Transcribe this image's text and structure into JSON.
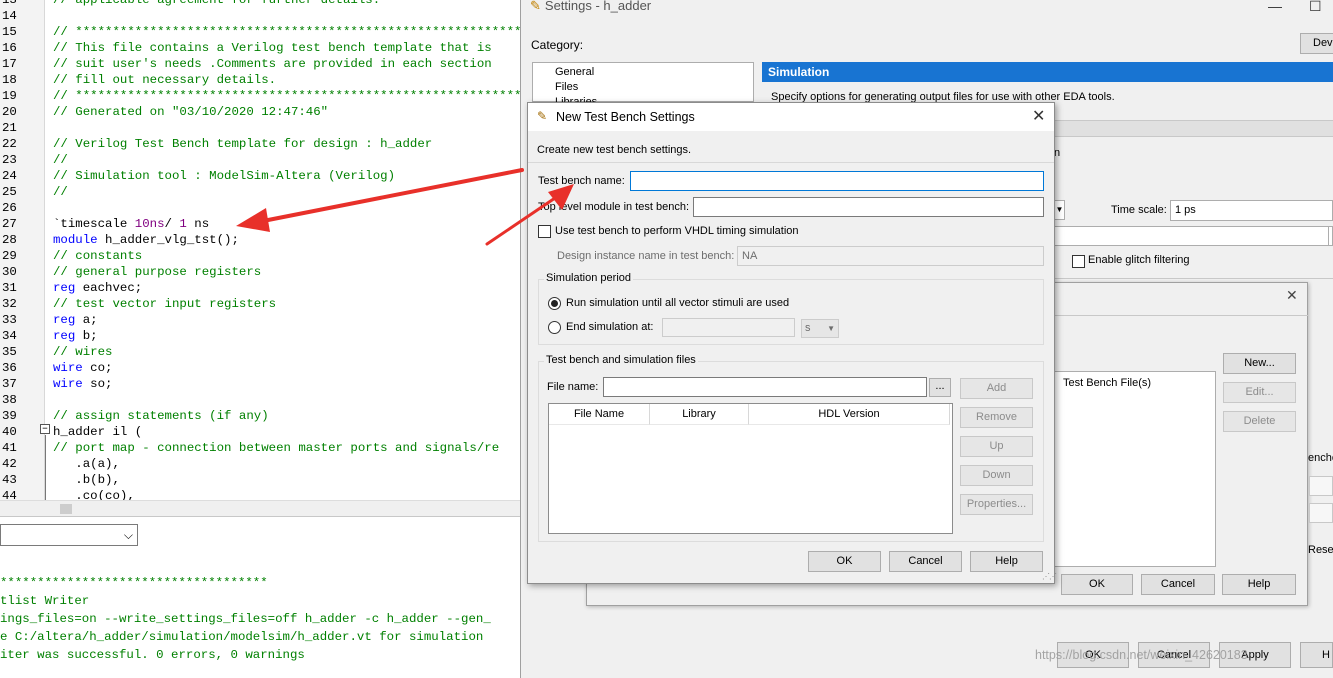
{
  "editor": {
    "lines": [
      {
        "num": "13",
        "parts": [
          {
            "t": "// applicable agreement for further details.",
            "c": "comment"
          }
        ]
      },
      {
        "num": "14",
        "parts": []
      },
      {
        "num": "15",
        "parts": [
          {
            "t": "// ********************************************************************",
            "c": "comment"
          }
        ]
      },
      {
        "num": "16",
        "parts": [
          {
            "t": "// This file contains a Verilog test bench template that is",
            "c": "comment"
          }
        ]
      },
      {
        "num": "17",
        "parts": [
          {
            "t": "// suit user's needs .Comments are provided in each section",
            "c": "comment"
          }
        ]
      },
      {
        "num": "18",
        "parts": [
          {
            "t": "// fill out necessary details.",
            "c": "comment"
          }
        ]
      },
      {
        "num": "19",
        "parts": [
          {
            "t": "// ********************************************************************",
            "c": "comment"
          }
        ]
      },
      {
        "num": "20",
        "parts": [
          {
            "t": "// Generated on \"03/10/2020 12:47:46\"",
            "c": "comment"
          }
        ]
      },
      {
        "num": "21",
        "parts": []
      },
      {
        "num": "22",
        "parts": [
          {
            "t": "// Verilog Test Bench template for design : h_adder",
            "c": "comment"
          }
        ]
      },
      {
        "num": "23",
        "parts": [
          {
            "t": "//",
            "c": "comment"
          }
        ]
      },
      {
        "num": "24",
        "parts": [
          {
            "t": "// Simulation tool : ModelSim-Altera (Verilog)",
            "c": "comment"
          }
        ]
      },
      {
        "num": "25",
        "parts": [
          {
            "t": "//",
            "c": "comment"
          }
        ]
      },
      {
        "num": "26",
        "parts": []
      },
      {
        "num": "27",
        "parts": [
          {
            "t": "`timescale ",
            "c": "text"
          },
          {
            "t": "10ns",
            "c": "num"
          },
          {
            "t": "/ ",
            "c": "text"
          },
          {
            "t": "1",
            "c": "num"
          },
          {
            "t": " ns",
            "c": "text"
          }
        ]
      },
      {
        "num": "28",
        "parts": [
          {
            "t": "module",
            "c": "kw"
          },
          {
            "t": " h_adder_vlg_tst();",
            "c": "text"
          }
        ]
      },
      {
        "num": "29",
        "parts": [
          {
            "t": "// constants",
            "c": "comment"
          }
        ]
      },
      {
        "num": "30",
        "parts": [
          {
            "t": "// general purpose registers",
            "c": "comment"
          }
        ]
      },
      {
        "num": "31",
        "parts": [
          {
            "t": "reg",
            "c": "kw"
          },
          {
            "t": " eachvec;",
            "c": "text"
          }
        ]
      },
      {
        "num": "32",
        "parts": [
          {
            "t": "// test vector input registers",
            "c": "comment"
          }
        ]
      },
      {
        "num": "33",
        "parts": [
          {
            "t": "reg",
            "c": "kw"
          },
          {
            "t": " a;",
            "c": "text"
          }
        ]
      },
      {
        "num": "34",
        "parts": [
          {
            "t": "reg",
            "c": "kw"
          },
          {
            "t": " b;",
            "c": "text"
          }
        ]
      },
      {
        "num": "35",
        "parts": [
          {
            "t": "// wires",
            "c": "comment"
          }
        ]
      },
      {
        "num": "36",
        "parts": [
          {
            "t": "wire",
            "c": "kw"
          },
          {
            "t": " co;",
            "c": "text"
          }
        ]
      },
      {
        "num": "37",
        "parts": [
          {
            "t": "wire",
            "c": "kw"
          },
          {
            "t": " so;",
            "c": "text"
          }
        ]
      },
      {
        "num": "38",
        "parts": []
      },
      {
        "num": "39",
        "parts": [
          {
            "t": "// assign statements (if any)",
            "c": "comment"
          }
        ]
      },
      {
        "num": "40",
        "parts": [
          {
            "t": "h_adder il (",
            "c": "text"
          }
        ]
      },
      {
        "num": "41",
        "parts": [
          {
            "t": "// port map - connection between master ports and signals/re",
            "c": "comment"
          }
        ]
      },
      {
        "num": "42",
        "parts": [
          {
            "t": "   .a(a),",
            "c": "text"
          }
        ]
      },
      {
        "num": "43",
        "parts": [
          {
            "t": "   .b(b),",
            "c": "text"
          }
        ]
      },
      {
        "num": "44",
        "parts": [
          {
            "t": "   .co(co),",
            "c": "text"
          }
        ]
      }
    ]
  },
  "messages": {
    "lines": [
      "************************************",
      "tlist Writer",
      "ings_files=on --write_settings_files=off h_adder -c h_adder --gen_",
      "e C:/altera/h_adder/simulation/modelsim/h_adder.vt for simulation",
      "iter was successful. 0 errors, 0 warnings"
    ]
  },
  "settings": {
    "title": "Settings - h_adder",
    "category_label": "Category:",
    "category_items": [
      "General",
      "Files",
      "Libraries"
    ],
    "device_button": "Devi",
    "section_header": "Simulation",
    "section_desc": "Specify options for generating output files for use with other EDA tools.",
    "frag_n": "n",
    "time_scale_label": "Time scale:",
    "time_scale_value": "1 ps",
    "glitch_label": "Enable glitch filtering",
    "buttons": {
      "ok": "OK",
      "cancel": "Cancel",
      "apply": "Apply",
      "help": "H"
    }
  },
  "mid_dialog": {
    "file_list_header": "Test Bench File(s)",
    "buttons": {
      "new": "New...",
      "edit": "Edit...",
      "delete": "Delete",
      "ok": "OK",
      "cancel": "Cancel",
      "help": "Help"
    },
    "right_frag_1": "enche",
    "right_frag_2": "Rese"
  },
  "ntb_dialog": {
    "title": "New Test Bench Settings",
    "description": "Create new test bench settings.",
    "tb_name_label": "Test bench name:",
    "tb_name_value": "",
    "top_module_label": "Top level module in test bench:",
    "top_module_value": "",
    "vhdl_timing_label": "Use test bench to perform VHDL timing simulation",
    "design_instance_label": "Design instance name in test bench:",
    "design_instance_value": "NA",
    "sim_period_title": "Simulation period",
    "run_until_label": "Run simulation until all vector stimuli are used",
    "end_sim_label": "End simulation at:",
    "end_sim_unit": "s",
    "files_group_title": "Test bench and simulation files",
    "file_name_label": "File name:",
    "browse": "...",
    "columns": [
      "File Name",
      "Library",
      "HDL Version"
    ],
    "side_buttons": {
      "add": "Add",
      "remove": "Remove",
      "up": "Up",
      "down": "Down",
      "properties": "Properties..."
    },
    "buttons": {
      "ok": "OK",
      "cancel": "Cancel",
      "help": "Help"
    }
  },
  "watermark": "https://blog.csdn.net/weixin_42620183",
  "colors": {
    "accent": "#1874d2",
    "comment": "#008000",
    "keyword": "#0000ff",
    "number": "#800080",
    "arrow": "#e8302a"
  }
}
